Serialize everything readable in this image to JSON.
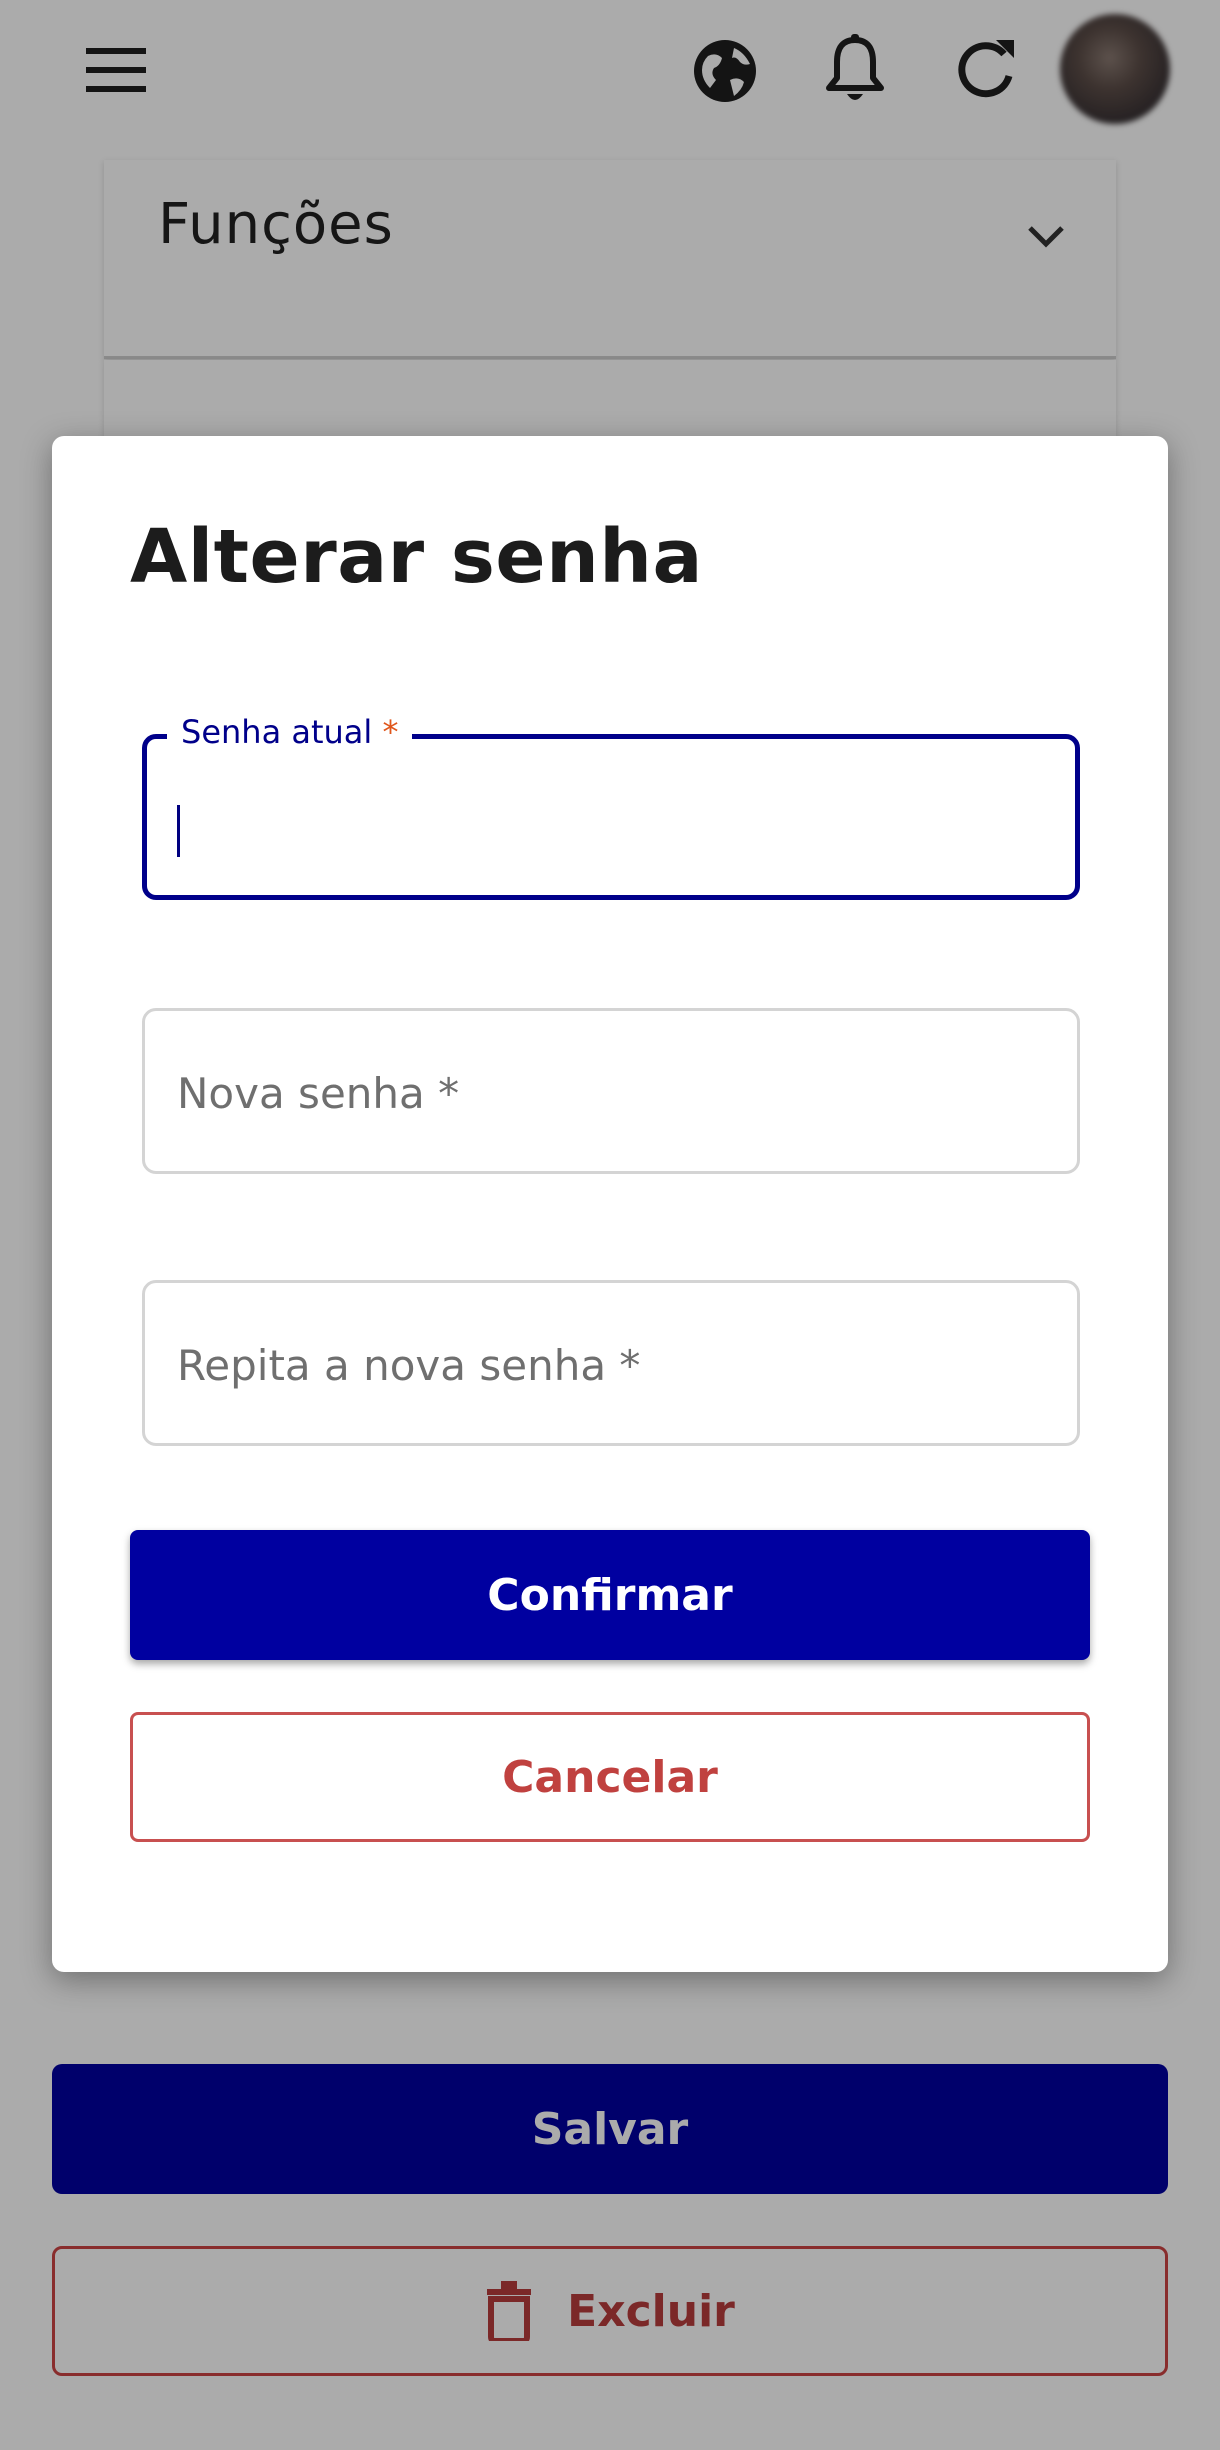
{
  "topbar": {
    "icons": [
      "menu-icon",
      "globe-icon",
      "bell-icon",
      "refresh-icon"
    ]
  },
  "accordion": {
    "label": "Funções"
  },
  "dialog": {
    "title": "Alterar senha",
    "fields": {
      "current_password": {
        "label": "Senha atual",
        "required_mark": "*",
        "value": ""
      },
      "new_password": {
        "placeholder": "Nova senha *",
        "value": ""
      },
      "repeat_password": {
        "placeholder": "Repita a nova senha *",
        "value": ""
      }
    },
    "confirm_label": "Confirmar",
    "cancel_label": "Cancelar"
  },
  "footer": {
    "save_label": "Salvar",
    "delete_label": "Excluir"
  },
  "colors": {
    "primary": "#0000a0",
    "danger": "#c0413f",
    "focus": "#00008a",
    "required": "#e0561b"
  }
}
